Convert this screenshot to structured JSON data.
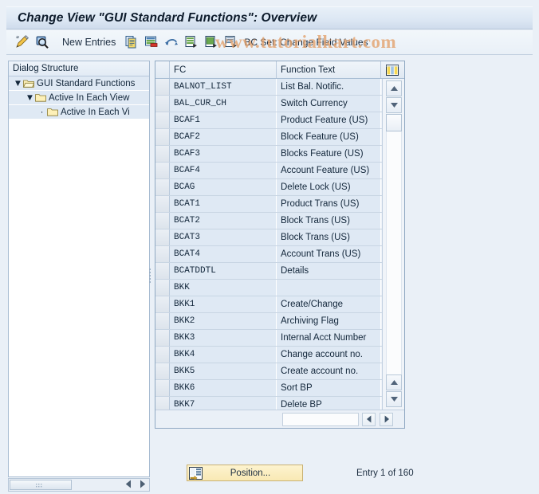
{
  "window": {
    "title": "Change View \"GUI Standard Functions\": Overview"
  },
  "watermark": {
    "text": "www.tutorialkart.com"
  },
  "toolbar": {
    "icons": [
      {
        "name": "display-change-icon",
        "label": ""
      },
      {
        "name": "magnifier-details-icon",
        "label": ""
      }
    ],
    "new_entries_label": "New Entries",
    "action_icons": [
      {
        "name": "copy-as-icon"
      },
      {
        "name": "delete-row-icon"
      },
      {
        "name": "undo-icon"
      },
      {
        "name": "select-all-icon"
      },
      {
        "name": "deselect-all-icon"
      },
      {
        "name": "bc-set-icon"
      }
    ],
    "bc_set_label": "BC Set: Change Field Values"
  },
  "sidebar": {
    "header": "Dialog Structure",
    "items": [
      {
        "label": "GUI Standard Functions",
        "level": 1,
        "expanded": true,
        "toggle": "▼",
        "folder": "open-folder-icon"
      },
      {
        "label": "Active In Each View",
        "level": 2,
        "expanded": true,
        "toggle": "▼",
        "folder": "folder-icon"
      },
      {
        "label": "Active In Each Vi",
        "level": 3,
        "expanded": false,
        "toggle": "·",
        "folder": "folder-icon"
      }
    ]
  },
  "table": {
    "columns": [
      {
        "key": "fc",
        "label": "FC"
      },
      {
        "key": "ft",
        "label": "Function Text"
      }
    ],
    "config_icon": "table-settings-icon",
    "rows": [
      {
        "fc": "BALNOT_LIST",
        "ft": "List Bal. Notific."
      },
      {
        "fc": "BAL_CUR_CH",
        "ft": "Switch Currency"
      },
      {
        "fc": "BCAF1",
        "ft": "Product Feature (US)"
      },
      {
        "fc": "BCAF2",
        "ft": "Block Feature (US)"
      },
      {
        "fc": "BCAF3",
        "ft": "Blocks Feature (US)"
      },
      {
        "fc": "BCAF4",
        "ft": "Account Feature (US)"
      },
      {
        "fc": "BCAG",
        "ft": "Delete Lock (US)"
      },
      {
        "fc": "BCAT1",
        "ft": "Product Trans (US)"
      },
      {
        "fc": "BCAT2",
        "ft": "Block Trans (US)"
      },
      {
        "fc": "BCAT3",
        "ft": "Block Trans (US)"
      },
      {
        "fc": "BCAT4",
        "ft": "Account Trans (US)"
      },
      {
        "fc": "BCATDDTL",
        "ft": "Details"
      },
      {
        "fc": "BKK",
        "ft": ""
      },
      {
        "fc": "BKK1",
        "ft": "Create/Change"
      },
      {
        "fc": "BKK2",
        "ft": "Archiving Flag"
      },
      {
        "fc": "BKK3",
        "ft": "Internal Acct Number"
      },
      {
        "fc": "BKK4",
        "ft": "Change account no."
      },
      {
        "fc": "BKK5",
        "ft": "Create account no."
      },
      {
        "fc": "BKK6",
        "ft": "Sort BP"
      },
      {
        "fc": "BKK7",
        "ft": "Delete BP"
      }
    ]
  },
  "footer": {
    "position_button": "Position...",
    "entry_status": "Entry 1 of 160"
  },
  "colors": {
    "accent": "#f9e9b4",
    "row_bg": "#dfe9f4",
    "chrome": "#eaf0f7",
    "watermark": "#e3a06a"
  }
}
